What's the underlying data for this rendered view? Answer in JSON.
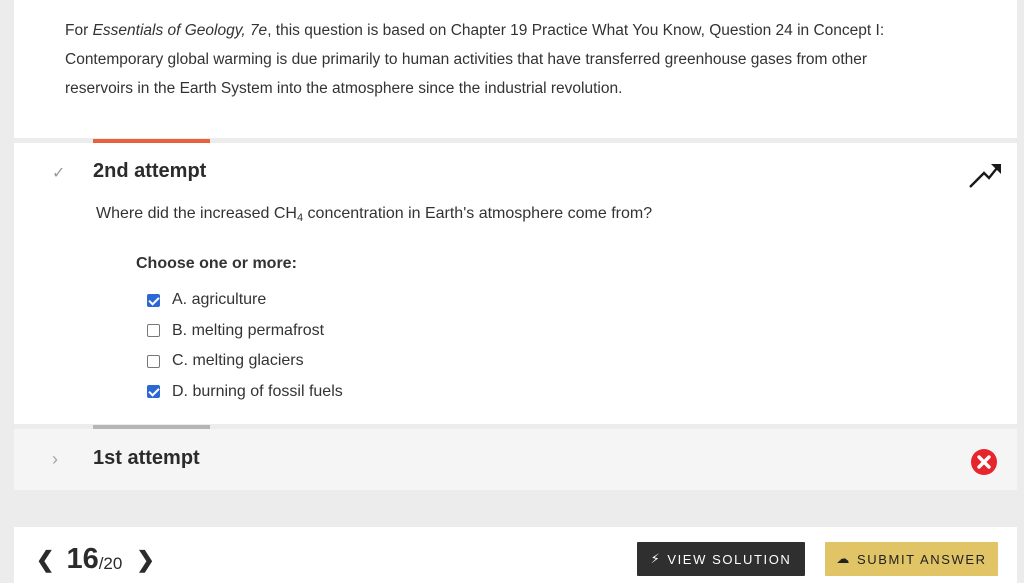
{
  "intro": {
    "prefix": "For ",
    "book_title": "Essentials of Geology, 7e",
    "text": ", this question is based on Chapter 19 Practice What You Know, Question 24 in Concept I: Contemporary global warming is due primarily to human activities that have transferred greenhouse gases from other reservoirs in the Earth System into the atmosphere since the industrial revolution."
  },
  "attempt2": {
    "title": "2nd attempt",
    "question_before": "Where did the increased CH",
    "question_sub": "4",
    "question_after": " concentration in Earth's atmosphere come from?",
    "choose_label": "Choose one or more:",
    "options": [
      {
        "label": "A. agriculture",
        "checked": true
      },
      {
        "label": "B. melting permafrost",
        "checked": false
      },
      {
        "label": "C. melting glaciers",
        "checked": false
      },
      {
        "label": "D. burning of fossil fuels",
        "checked": true
      }
    ],
    "status_icon": "trend-up-icon"
  },
  "attempt1": {
    "title": "1st attempt",
    "status_icon": "incorrect-icon",
    "status_color": "#e5262d"
  },
  "footer": {
    "prev_arrow": "‹",
    "current": "16",
    "total": "/20",
    "next_arrow": "›",
    "view_solution": "VIEW SOLUTION",
    "submit": "SUBMIT ANSWER"
  }
}
